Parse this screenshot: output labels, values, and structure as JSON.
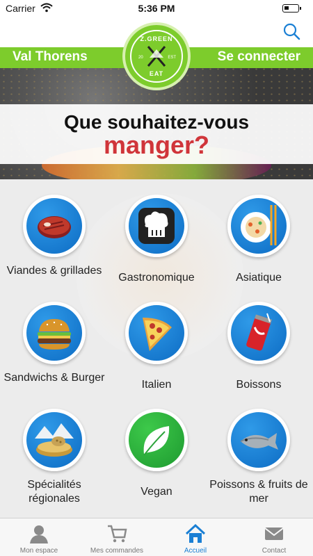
{
  "status": {
    "carrier": "Carrier",
    "time": "5:36 PM"
  },
  "header": {
    "location": "Val Thorens",
    "login": "Se connecter",
    "logo": {
      "top": "Z.GREEN",
      "bottom": "EAT",
      "left": "20",
      "right": "EST"
    }
  },
  "title": {
    "line1": "Que souhaitez-vous",
    "line2": "manger?"
  },
  "categories": [
    {
      "label": "Viandes & grillades",
      "icon": "steak-icon"
    },
    {
      "label": "Gastronomique",
      "icon": "chef-hat-icon"
    },
    {
      "label": "Asiatique",
      "icon": "asian-bowl-icon"
    },
    {
      "label": "Sandwichs & Burger",
      "icon": "burger-icon"
    },
    {
      "label": "Italien",
      "icon": "pizza-icon"
    },
    {
      "label": "Boissons",
      "icon": "soda-can-icon"
    },
    {
      "label": "Spécialités régionales",
      "icon": "cheese-mountain-icon"
    },
    {
      "label": "Vegan",
      "icon": "leaf-icon"
    },
    {
      "label": "Poissons & fruits de mer",
      "icon": "fish-icon"
    }
  ],
  "tabs": [
    {
      "label": "Mon espace",
      "icon": "user-icon"
    },
    {
      "label": "Mes commandes",
      "icon": "cart-icon"
    },
    {
      "label": "Accueil",
      "icon": "home-icon",
      "active": true
    },
    {
      "label": "Contact",
      "icon": "mail-icon"
    }
  ],
  "colors": {
    "green": "#7dcc2c",
    "accent_red": "#d0353a",
    "blue": "#1a7fd4"
  }
}
